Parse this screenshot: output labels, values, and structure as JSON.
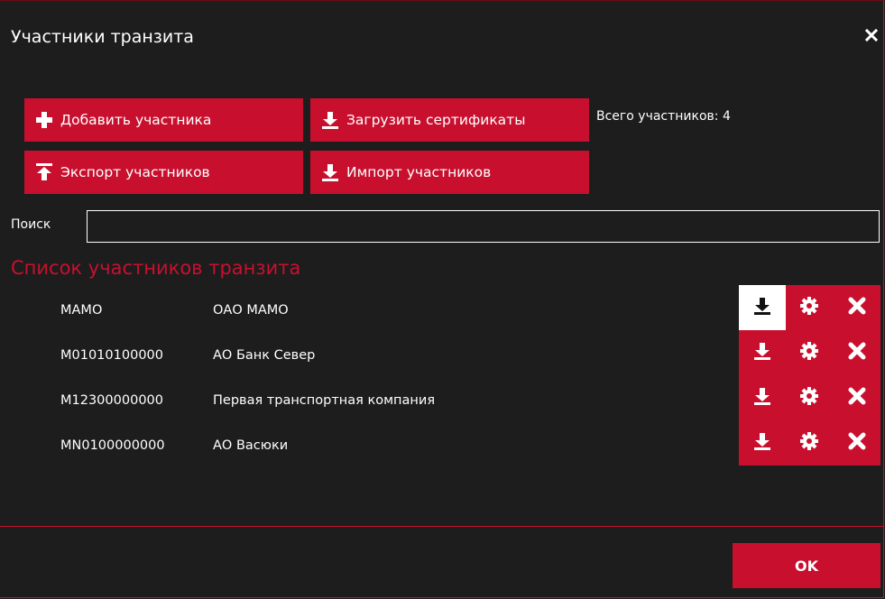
{
  "window": {
    "title": "Участники транзита"
  },
  "toolbar": {
    "add_label": "Добавить участника",
    "load_certs_label": "Загрузить сертификаты",
    "export_label": "Экспорт участников",
    "import_label": "Импорт участников",
    "total_label": "Всего участников: 4"
  },
  "search": {
    "label": "Поиск",
    "value": "",
    "placeholder": ""
  },
  "list": {
    "title": "Список участников транзита",
    "items": [
      {
        "code": "MAMO",
        "name": "ОАО МАМО"
      },
      {
        "code": "M01010100000",
        "name": "АО Банк Север"
      },
      {
        "code": "M12300000000",
        "name": "Первая транспортная компания"
      },
      {
        "code": "MN0100000000",
        "name": "АО Васюки"
      }
    ]
  },
  "footer": {
    "ok_label": "OK"
  },
  "colors": {
    "accent": "#c8102e",
    "background": "#1d1d1d",
    "text": "#ffffff"
  }
}
